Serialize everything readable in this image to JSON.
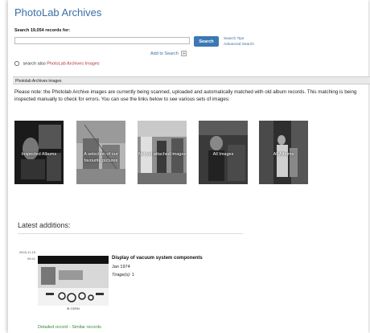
{
  "header": {
    "title": "PhotoLab Archives"
  },
  "search": {
    "label": "Search 19,054 records for:",
    "value": "",
    "button": "Search",
    "tips": "Search Tips",
    "advanced": "Advanced Search",
    "add_to_search": "Add to Search",
    "add_icon": "+",
    "also_prefix": "search also",
    "also_link": "PhotoLab Archives Images"
  },
  "section": {
    "title": "Photolab Archives images",
    "note": "Please note: the Photolab Archive images are currently being scanned, uploaded and automatically matched with old album records. This matching is being inspected manually to check for errors. You can use the links below to see various sets of images:"
  },
  "tiles": [
    {
      "label": "Inspected Albums"
    },
    {
      "label": "A selection of our favourite pictures"
    },
    {
      "label": "Not yet attached images"
    },
    {
      "label": "All Images"
    },
    {
      "label": "All Albums"
    }
  ],
  "latest": {
    "heading": "Latest additions:",
    "record": {
      "date": "2018-11-15",
      "time": "09:41",
      "title": "Display of vacuum system components",
      "rec_date": "Jan 1974",
      "copies_label": "Tirage(s):",
      "copies": "1",
      "thumb_caption": "⊕ CERN",
      "detailed": "Detailed record",
      "separator": "-",
      "similar": "Similar records"
    }
  }
}
